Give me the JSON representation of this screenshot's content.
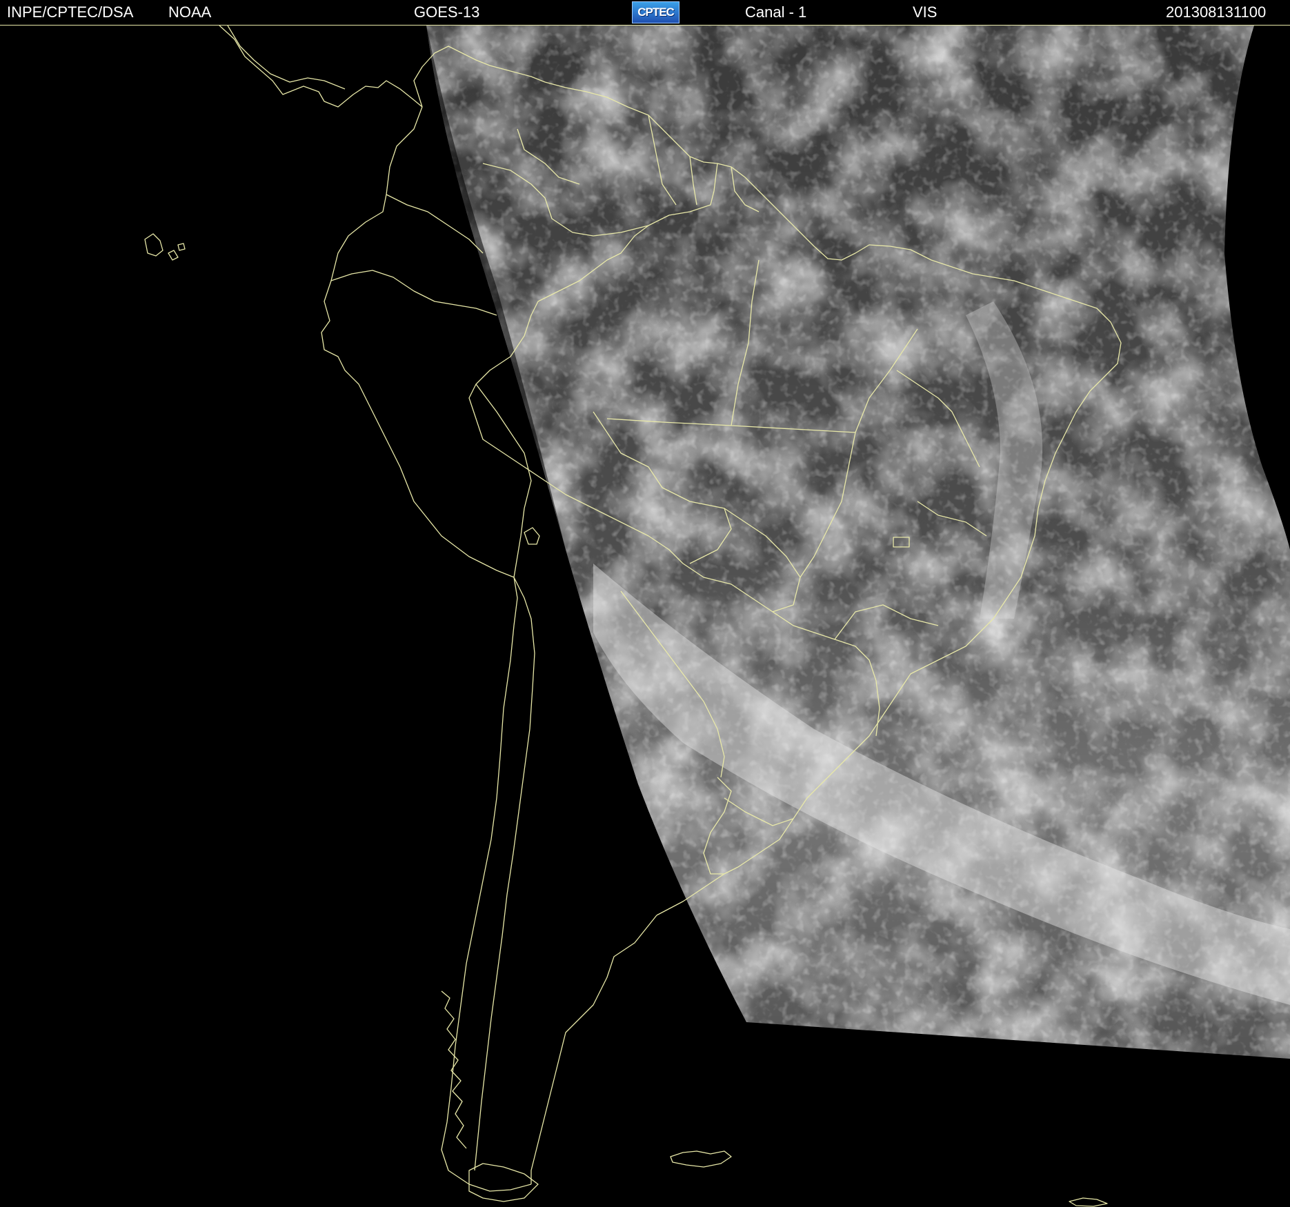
{
  "header": {
    "agency": "INPE/CPTEC/DSA",
    "source": "NOAA",
    "satellite": "GOES-13",
    "logo_text": "CPTEC",
    "channel": "Canal - 1",
    "band": "VIS",
    "timestamp": "201308131100"
  },
  "colors": {
    "background": "#000000",
    "boundary_lines": "#e8e8a8",
    "header_text": "#ffffff",
    "logo_blue": "#2a6fd0"
  },
  "map": {
    "projection_view": "South America, GOES-13 visible channel imagery",
    "icons": [
      "cptec-logo"
    ]
  }
}
